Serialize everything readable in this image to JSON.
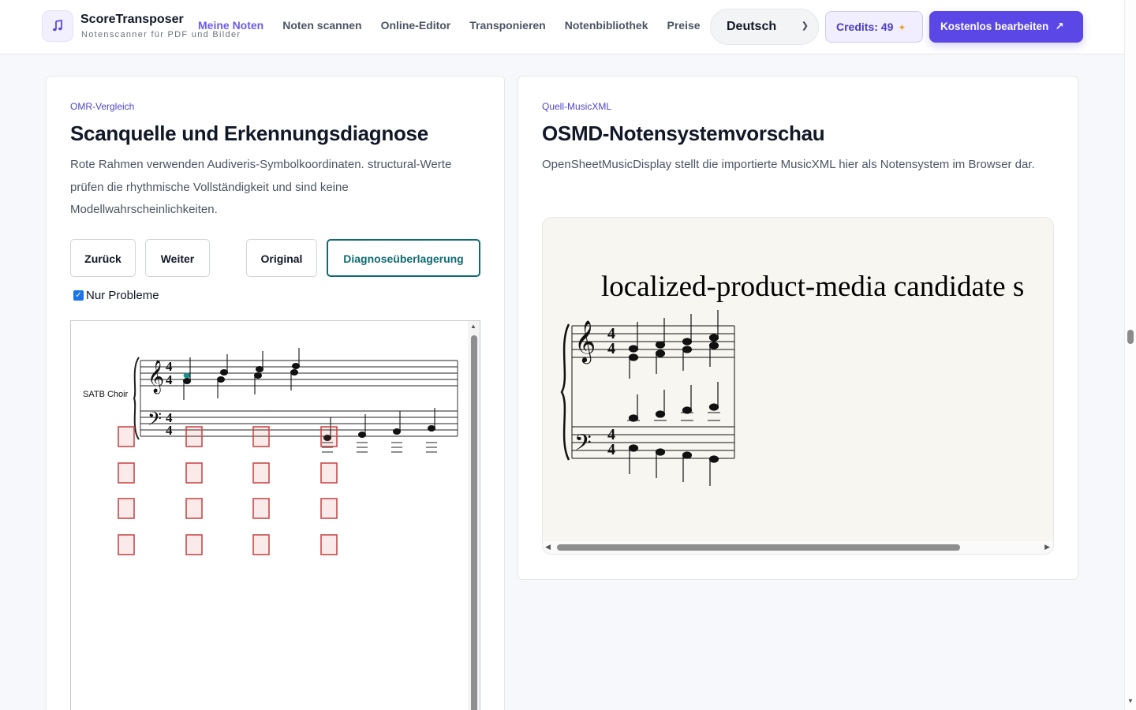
{
  "brand": {
    "name": "ScoreTransposer",
    "tagline": "Notenscanner für PDF und Bilder",
    "icon": "music-note-icon"
  },
  "nav": [
    {
      "label": "Meine Noten",
      "active": true
    },
    {
      "label": "Noten scannen"
    },
    {
      "label": "Online-Editor"
    },
    {
      "label": "Transponieren"
    },
    {
      "label": "Notenbibliothek"
    },
    {
      "label": "Preise"
    }
  ],
  "language": {
    "selected": "Deutsch"
  },
  "credits": {
    "label": "Credits: 49",
    "icon": "sparkle-icon"
  },
  "cta": {
    "label": "Kostenlos bearbeiten",
    "icon": "arrow-up-right-icon"
  },
  "left_panel": {
    "eyebrow": "OMR-Vergleich",
    "title": "Scanquelle und Erkennungsdiagnose",
    "description": "Rote Rahmen verwenden Audiveris-Symbolkoordinaten. structural-Werte prüfen die rhythmische Vollständigkeit und sind keine Modellwahrscheinlichkeiten.",
    "buttons": {
      "back": "Zurück",
      "next": "Weiter",
      "original": "Original",
      "overlay": "Diagnoseüberlagerung"
    },
    "only_problems": {
      "label": "Nur Probleme",
      "checked": true
    },
    "score": {
      "part_name": "SATB Choir",
      "time_signature": "4/4"
    }
  },
  "right_panel": {
    "eyebrow": "Quell-MusicXML",
    "title": "OSMD-Notensystemvorschau",
    "description": "OpenSheetMusicDisplay stellt die importierte MusicXML hier als Notensystem im Browser dar.",
    "preview_title": "localized-product-media candidate s"
  },
  "colors": {
    "accent": "#5b47e6",
    "active_nav": "#6d5ce8",
    "diagnostic_box": "#c94a4a",
    "overlay_button": "#0f6b72"
  }
}
